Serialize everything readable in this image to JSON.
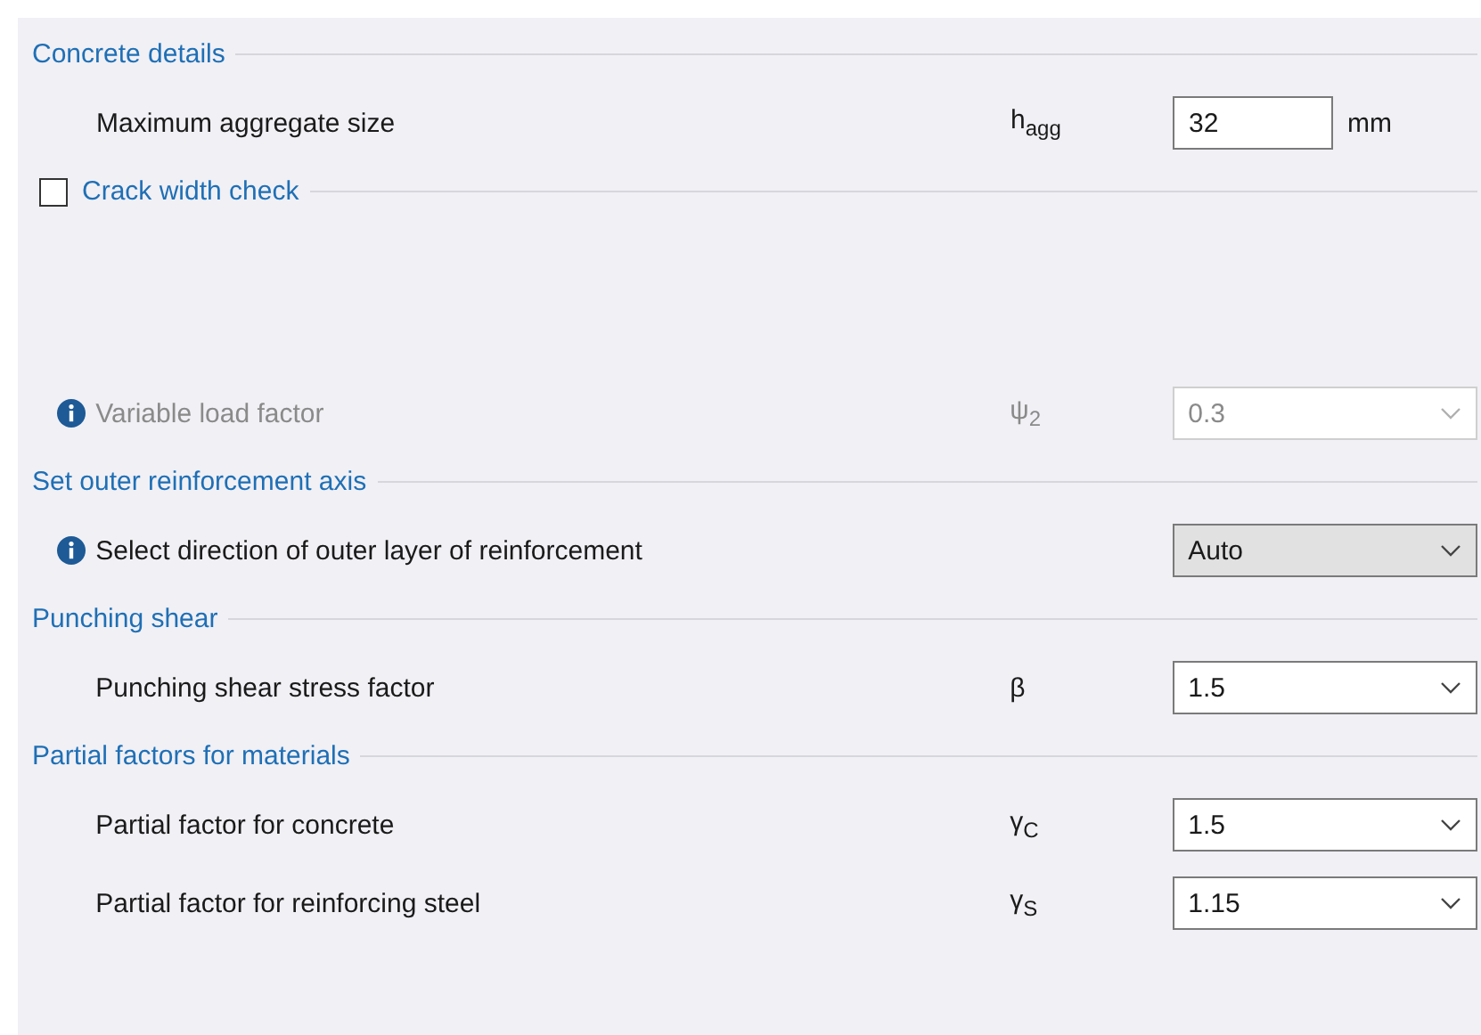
{
  "sections": [
    {
      "kind": "header",
      "title": "Concrete details",
      "rows": [
        {
          "label": "Maximum aggregate size",
          "info": false,
          "disabled": false,
          "symbol": "h$_{agg}$",
          "kind": "input",
          "value": "32",
          "unit": "mm"
        }
      ]
    },
    {
      "kind": "checkbox_header",
      "title": "Crack width check",
      "checked": false,
      "rows": [
        {
          "label": "Variable load factor",
          "info": true,
          "disabled": true,
          "symbol": "ψ$_{2}$",
          "kind": "combo",
          "value": "0.3"
        }
      ]
    },
    {
      "kind": "header",
      "title": "Set outer reinforcement axis",
      "rows": [
        {
          "label": "Select direction of outer layer of reinforcement",
          "info": true,
          "disabled": false,
          "kind": "dropdown",
          "value": "Auto"
        }
      ]
    },
    {
      "kind": "header",
      "title": "Punching shear",
      "rows": [
        {
          "label": "Punching shear stress factor",
          "info": false,
          "disabled": false,
          "symbol": "β",
          "kind": "combo",
          "value": "1.5"
        }
      ]
    },
    {
      "kind": "header",
      "title": "Partial factors for materials",
      "rows": [
        {
          "label": "Partial factor for concrete",
          "info": false,
          "disabled": false,
          "symbol": "γ$_{C}$",
          "kind": "combo",
          "value": "1.5"
        },
        {
          "label": "Partial factor for reinforcing steel",
          "info": false,
          "disabled": false,
          "symbol": "γ$_{S}$",
          "kind": "combo",
          "value": "1.15"
        }
      ]
    }
  ]
}
